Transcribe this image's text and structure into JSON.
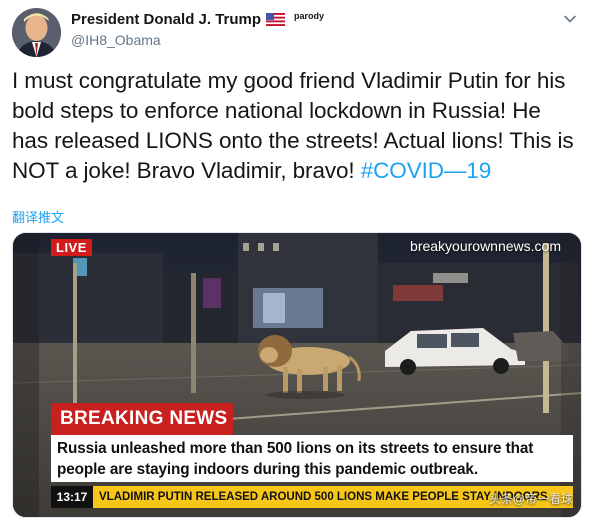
{
  "author": {
    "display_name": "President Donald J. Trump",
    "flag_icon": "us-flag-icon",
    "parody_label": "parody",
    "handle": "@IH8_Obama"
  },
  "tweet": {
    "text": "I must congratulate my good friend Vladimir Putin for his bold steps to enforce national lockdown in Russia! He has released LIONS onto the streets! Actual lions! This is NOT a joke! Bravo Vladimir, bravo!",
    "hashtag": "#COVID—19",
    "translate_label": "翻译推文"
  },
  "media": {
    "live_badge": "LIVE",
    "site_url": "breakyourownnews.com",
    "breaking_label": "BREAKING NEWS",
    "headline": "Russia unleashed more than 500 lions on its streets to ensure that people are staying indoors during this pandemic outbreak.",
    "ticker_time": "13:17",
    "ticker_text": "VLADIMIR PUTIN RELEASED AROUND 500 LIONS MAKE PEOPLE STAY INDOORS",
    "watermark": "头条@帝一看球"
  },
  "colors": {
    "link_blue": "#1da1f2",
    "breaking_red": "#c8201e",
    "ticker_yellow": "#f7c619"
  }
}
